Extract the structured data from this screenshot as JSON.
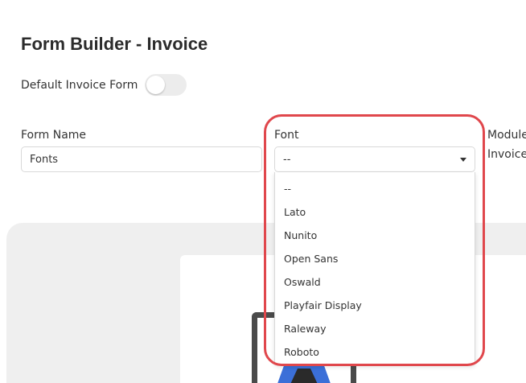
{
  "header": {
    "title": "Form Builder - Invoice"
  },
  "default_toggle": {
    "label": "Default Invoice Form",
    "enabled": false
  },
  "form_name": {
    "label": "Form Name",
    "value": "Fonts"
  },
  "font": {
    "label": "Font",
    "selected": "--",
    "options": [
      "--",
      "Lato",
      "Nunito",
      "Open Sans",
      "Oswald",
      "Playfair Display",
      "Raleway",
      "Roboto"
    ]
  },
  "module": {
    "label": "Module",
    "value": "Invoice"
  },
  "colors": {
    "highlight": "#e0474c",
    "accent": "#3b6fd8"
  }
}
